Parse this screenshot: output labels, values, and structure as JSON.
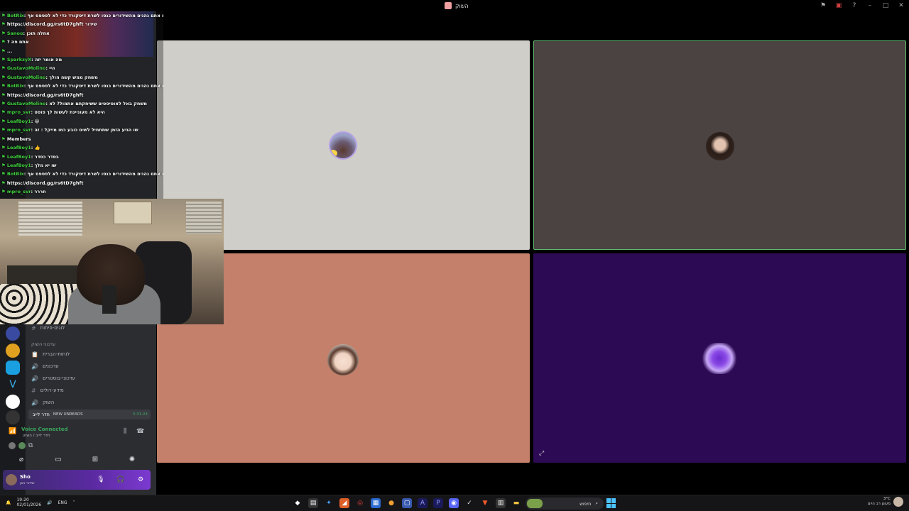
{
  "titlebar": {
    "title": "השוק",
    "icons": [
      "pin-icon",
      "screen-icon",
      "help-icon",
      "minimize-icon",
      "maximize-icon",
      "close-icon"
    ]
  },
  "chat": {
    "lines": [
      {
        "name": "BotRix",
        "text": ": אם אתם נהנים מהשידורים כנסו לשרת דיסקורד כדי לא לפספס אף"
      },
      {
        "name": "",
        "text": "https://discord.gg/rs6tD7ghft שידור"
      },
      {
        "name": "Sanoo",
        "text": ": אחלה תוכן"
      },
      {
        "name": "",
        "text": "? אתם פה"
      },
      {
        "name": "",
        "text": "..."
      },
      {
        "name": "SparkzyX",
        "text": ": מה אומר יזה"
      },
      {
        "name": "GustavoMolino",
        "text": ": היי"
      },
      {
        "name": "GustavoMolino",
        "text": ": משחק ממש קשה הולך"
      },
      {
        "name": "BotRix",
        "text": ": אם אתם נהנים מהשידורים כנסו לשרת דיסקורד כדי לא לפספס אף"
      },
      {
        "name": "",
        "text": "https://discord.gg/rs6tD7ghft"
      },
      {
        "name": "GustavoMolino",
        "text": ": משחק באל לאוטיסטים ששיחקתם אתמול? לא"
      },
      {
        "name": "mpro_svr",
        "text": ": היא לא מעוניינת לעשות לך פוסט"
      },
      {
        "name": "LeafBoy1",
        "text": ": 😀"
      },
      {
        "name": "mpro_svr",
        "text": ": שו הגיע הזמן שתתחיל לשים כובע כמו מייקל : זה"
      },
      {
        "name": "",
        "text": "Members"
      },
      {
        "name": "LeafBoy1",
        "text": ": 👍"
      },
      {
        "name": "LeafBoy1",
        "text": ": בסדר כסדר"
      },
      {
        "name": "LeafBoy1",
        "text": ": שו יא מלך"
      },
      {
        "name": "BotRix",
        "text": ": אם אתם נהנים מהשידורים כנסו לשרת דיסקורד כדי לא לפספס אף"
      },
      {
        "name": "",
        "text": "https://discord.gg/rs6tD7ghft"
      },
      {
        "name": "mpro_svr",
        "text": ": חררר"
      }
    ]
  },
  "sidebar": {
    "channels": [
      {
        "icon": "#",
        "label": "לוגים-פיתוח"
      },
      {
        "icon": "",
        "label": "עדכוני השוק",
        "category": true
      },
      {
        "icon": "📋",
        "label": "לוחות-הברית"
      },
      {
        "icon": "🔊",
        "label": "עדכונים"
      },
      {
        "icon": "🔊",
        "label": "עדכוני-בוסטרים"
      },
      {
        "icon": "#",
        "label": "מידע-רולים"
      },
      {
        "icon": "🔊",
        "label": "השוק"
      }
    ],
    "voice_channel": {
      "label": "חדר לייב",
      "badge": "NEW UNREADS",
      "timer": "3:31:24"
    },
    "voice_status": {
      "label": "Voice Connected",
      "sub": "חדר לייב / השוק"
    },
    "user": {
      "name": "Sho",
      "status": "שידור כאן"
    }
  },
  "taskbar": {
    "time": "19:20",
    "date": "02/01/2026",
    "lang": "ENG",
    "search_placeholder": "חיפוש",
    "weather": "3°C",
    "weather_sub": "מעונן רב היום"
  },
  "colors": {
    "tile1": "#cfcec8",
    "tile2": "#4a4341",
    "tile3": "#c4806a",
    "tile4": "#2d0a54",
    "speaking": "#5fbf6f",
    "chat_name": "#3ed13e"
  }
}
